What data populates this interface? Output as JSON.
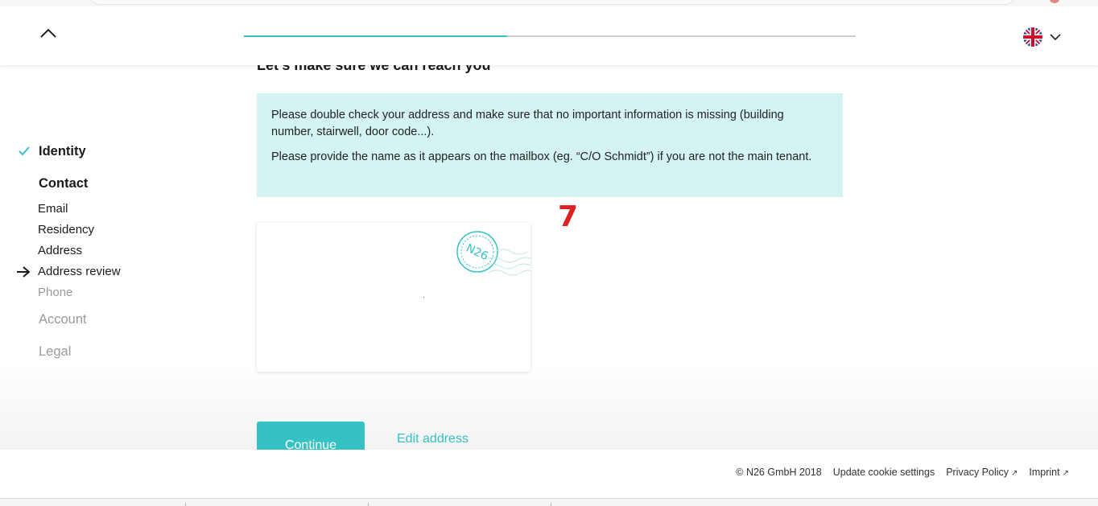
{
  "header": {
    "progress_fraction": 0.43,
    "language": "English (UK)",
    "accent_color": "#36c2c4"
  },
  "sidebar": {
    "sections": [
      {
        "label": "Identity",
        "state": "completed"
      },
      {
        "label": "Contact",
        "state": "current",
        "items": [
          {
            "label": "Email",
            "state": "done"
          },
          {
            "label": "Residency",
            "state": "done"
          },
          {
            "label": "Address",
            "state": "done"
          },
          {
            "label": "Address review",
            "state": "current"
          },
          {
            "label": "Phone",
            "state": "upcoming"
          }
        ]
      },
      {
        "label": "Account",
        "state": "upcoming"
      },
      {
        "label": "Legal",
        "state": "upcoming"
      }
    ]
  },
  "main": {
    "heading": "Let’s make sure we can reach you",
    "info_paragraphs": [
      "Please double check your address and make sure that no important information is missing (building number, stairwell, door code...).",
      "Please provide the name as it appears on the mailbox (eg. “C/O Schmidt”) if you are not the main tenant."
    ],
    "stamp_text": "N26",
    "annotation": "7",
    "continue_label": "Continue",
    "edit_label": "Edit address"
  },
  "footer": {
    "copyright": "© N26 GmbH 2018",
    "cookie": "Update cookie settings",
    "privacy": "Privacy Policy",
    "imprint": "Imprint",
    "external_icon": "↗"
  }
}
